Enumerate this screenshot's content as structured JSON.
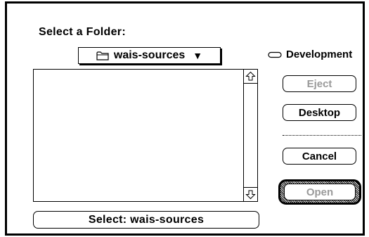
{
  "dialog": {
    "title": "Select a Folder:",
    "popup": {
      "folder_name": "wais-sources",
      "arrow": "▼",
      "icon": "folder-icon"
    },
    "volume": {
      "name": "Development",
      "icon": "disk-icon"
    },
    "scrollbar": {
      "up_icon": "scroll-up-arrow-icon",
      "down_icon": "scroll-down-arrow-icon"
    },
    "buttons": {
      "eject": "Eject",
      "desktop": "Desktop",
      "cancel": "Cancel",
      "open": "Open",
      "select": "Select: wais-sources"
    },
    "colors": {
      "disabled_text": "#9a9a9a",
      "foreground": "#000000",
      "background": "#ffffff"
    }
  }
}
